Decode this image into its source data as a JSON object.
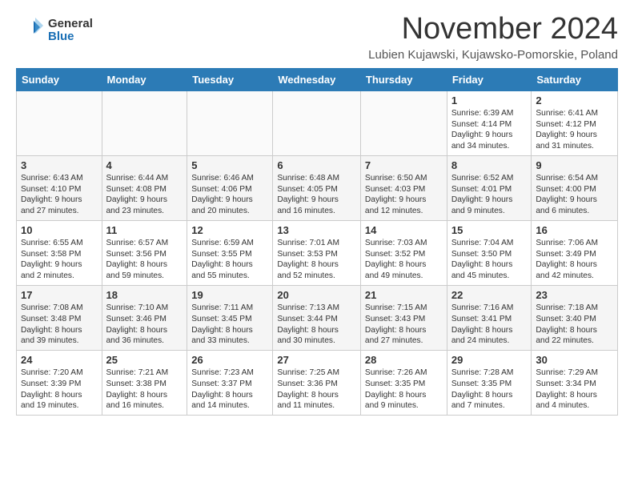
{
  "header": {
    "logo_general": "General",
    "logo_blue": "Blue",
    "month_title": "November 2024",
    "location": "Lubien Kujawski, Kujawsko-Pomorskie, Poland"
  },
  "days_of_week": [
    "Sunday",
    "Monday",
    "Tuesday",
    "Wednesday",
    "Thursday",
    "Friday",
    "Saturday"
  ],
  "weeks": [
    [
      {
        "day": "",
        "info": ""
      },
      {
        "day": "",
        "info": ""
      },
      {
        "day": "",
        "info": ""
      },
      {
        "day": "",
        "info": ""
      },
      {
        "day": "",
        "info": ""
      },
      {
        "day": "1",
        "info": "Sunrise: 6:39 AM\nSunset: 4:14 PM\nDaylight: 9 hours\nand 34 minutes."
      },
      {
        "day": "2",
        "info": "Sunrise: 6:41 AM\nSunset: 4:12 PM\nDaylight: 9 hours\nand 31 minutes."
      }
    ],
    [
      {
        "day": "3",
        "info": "Sunrise: 6:43 AM\nSunset: 4:10 PM\nDaylight: 9 hours\nand 27 minutes."
      },
      {
        "day": "4",
        "info": "Sunrise: 6:44 AM\nSunset: 4:08 PM\nDaylight: 9 hours\nand 23 minutes."
      },
      {
        "day": "5",
        "info": "Sunrise: 6:46 AM\nSunset: 4:06 PM\nDaylight: 9 hours\nand 20 minutes."
      },
      {
        "day": "6",
        "info": "Sunrise: 6:48 AM\nSunset: 4:05 PM\nDaylight: 9 hours\nand 16 minutes."
      },
      {
        "day": "7",
        "info": "Sunrise: 6:50 AM\nSunset: 4:03 PM\nDaylight: 9 hours\nand 12 minutes."
      },
      {
        "day": "8",
        "info": "Sunrise: 6:52 AM\nSunset: 4:01 PM\nDaylight: 9 hours\nand 9 minutes."
      },
      {
        "day": "9",
        "info": "Sunrise: 6:54 AM\nSunset: 4:00 PM\nDaylight: 9 hours\nand 6 minutes."
      }
    ],
    [
      {
        "day": "10",
        "info": "Sunrise: 6:55 AM\nSunset: 3:58 PM\nDaylight: 9 hours\nand 2 minutes."
      },
      {
        "day": "11",
        "info": "Sunrise: 6:57 AM\nSunset: 3:56 PM\nDaylight: 8 hours\nand 59 minutes."
      },
      {
        "day": "12",
        "info": "Sunrise: 6:59 AM\nSunset: 3:55 PM\nDaylight: 8 hours\nand 55 minutes."
      },
      {
        "day": "13",
        "info": "Sunrise: 7:01 AM\nSunset: 3:53 PM\nDaylight: 8 hours\nand 52 minutes."
      },
      {
        "day": "14",
        "info": "Sunrise: 7:03 AM\nSunset: 3:52 PM\nDaylight: 8 hours\nand 49 minutes."
      },
      {
        "day": "15",
        "info": "Sunrise: 7:04 AM\nSunset: 3:50 PM\nDaylight: 8 hours\nand 45 minutes."
      },
      {
        "day": "16",
        "info": "Sunrise: 7:06 AM\nSunset: 3:49 PM\nDaylight: 8 hours\nand 42 minutes."
      }
    ],
    [
      {
        "day": "17",
        "info": "Sunrise: 7:08 AM\nSunset: 3:48 PM\nDaylight: 8 hours\nand 39 minutes."
      },
      {
        "day": "18",
        "info": "Sunrise: 7:10 AM\nSunset: 3:46 PM\nDaylight: 8 hours\nand 36 minutes."
      },
      {
        "day": "19",
        "info": "Sunrise: 7:11 AM\nSunset: 3:45 PM\nDaylight: 8 hours\nand 33 minutes."
      },
      {
        "day": "20",
        "info": "Sunrise: 7:13 AM\nSunset: 3:44 PM\nDaylight: 8 hours\nand 30 minutes."
      },
      {
        "day": "21",
        "info": "Sunrise: 7:15 AM\nSunset: 3:43 PM\nDaylight: 8 hours\nand 27 minutes."
      },
      {
        "day": "22",
        "info": "Sunrise: 7:16 AM\nSunset: 3:41 PM\nDaylight: 8 hours\nand 24 minutes."
      },
      {
        "day": "23",
        "info": "Sunrise: 7:18 AM\nSunset: 3:40 PM\nDaylight: 8 hours\nand 22 minutes."
      }
    ],
    [
      {
        "day": "24",
        "info": "Sunrise: 7:20 AM\nSunset: 3:39 PM\nDaylight: 8 hours\nand 19 minutes."
      },
      {
        "day": "25",
        "info": "Sunrise: 7:21 AM\nSunset: 3:38 PM\nDaylight: 8 hours\nand 16 minutes."
      },
      {
        "day": "26",
        "info": "Sunrise: 7:23 AM\nSunset: 3:37 PM\nDaylight: 8 hours\nand 14 minutes."
      },
      {
        "day": "27",
        "info": "Sunrise: 7:25 AM\nSunset: 3:36 PM\nDaylight: 8 hours\nand 11 minutes."
      },
      {
        "day": "28",
        "info": "Sunrise: 7:26 AM\nSunset: 3:35 PM\nDaylight: 8 hours\nand 9 minutes."
      },
      {
        "day": "29",
        "info": "Sunrise: 7:28 AM\nSunset: 3:35 PM\nDaylight: 8 hours\nand 7 minutes."
      },
      {
        "day": "30",
        "info": "Sunrise: 7:29 AM\nSunset: 3:34 PM\nDaylight: 8 hours\nand 4 minutes."
      }
    ]
  ]
}
